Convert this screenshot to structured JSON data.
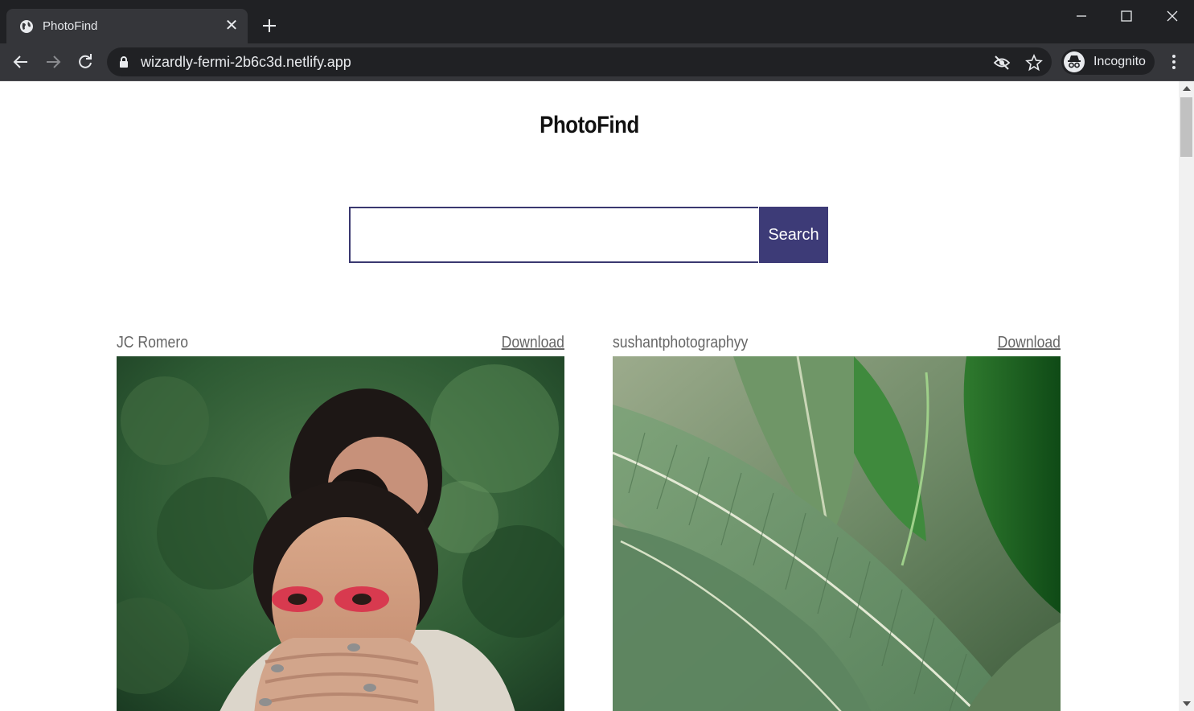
{
  "browser": {
    "tab_title": "PhotoFind",
    "url": "wizardly-fermi-2b6c3d.netlify.app",
    "profile_label": "Incognito"
  },
  "page": {
    "title": "PhotoFind",
    "search": {
      "value": "",
      "placeholder": "",
      "button_label": "Search"
    },
    "results": [
      {
        "author": "JC Romero",
        "download_label": "Download",
        "image": "woman-red-eye-makeup-photo"
      },
      {
        "author": "sushantphotographyy",
        "download_label": "Download",
        "image": "banana-leaves-photo"
      }
    ]
  },
  "colors": {
    "accent": "#3d3b77",
    "chrome_dark": "#202124",
    "chrome_mid": "#35363a"
  }
}
